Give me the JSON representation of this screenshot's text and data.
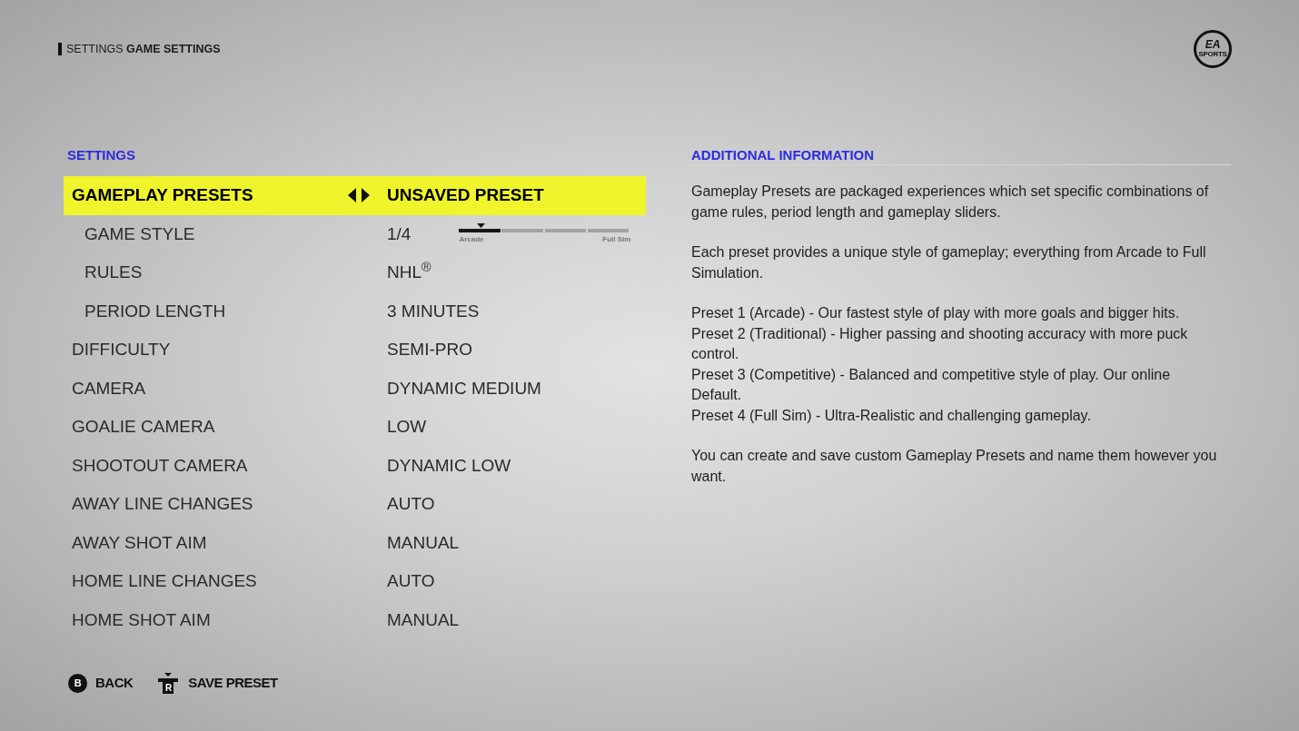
{
  "header": {
    "breadcrumb": "SETTINGS **GAME SETTINGS**",
    "logo": {
      "mark": "EA",
      "caption": "SPORTS"
    }
  },
  "settings": {
    "title": "SETTINGS",
    "rows": [
      {
        "label": "GAMEPLAY PRESETS",
        "value": "UNSAVED PRESET",
        "selected": true,
        "children": [
          {
            "kind": "slider",
            "label": "GAME STYLE",
            "value": "1/4",
            "selected": false,
            "level": 0.25,
            "min_label": "Arcade",
            "max_label": "Full Sim"
          },
          {
            "kind": "value",
            "label": "RULES",
            "value": "NHL$^{®}$",
            "selected": false
          },
          {
            "kind": "value",
            "label": "PERIOD LENGTH",
            "value": "3 MINUTES",
            "selected": false
          }
        ]
      },
      {
        "label": "DIFFICULTY",
        "value": "SEMI-PRO",
        "selected": false
      },
      {
        "label": "CAMERA",
        "value": "DYNAMIC MEDIUM",
        "selected": false
      },
      {
        "label": "GOALIE CAMERA",
        "value": "LOW",
        "selected": false
      },
      {
        "label": "SHOOTOUT CAMERA",
        "value": "DYNAMIC LOW",
        "selected": false
      },
      {
        "label": "AWAY LINE CHANGES",
        "value": "AUTO",
        "selected": false
      },
      {
        "label": "AWAY SHOT AIM",
        "value": "MANUAL",
        "selected": false
      },
      {
        "label": "HOME LINE CHANGES",
        "value": "AUTO",
        "selected": false
      },
      {
        "label": "HOME SHOT AIM",
        "value": "MANUAL",
        "selected": false
      }
    ]
  },
  "additional_information": {
    "title": "ADDITIONAL INFORMATION",
    "blocks": [
      {
        "lines": [
          "Gameplay Presets are packaged experiences which set specific combinations of game rules, period length and gameplay sliders."
        ]
      },
      {
        "lines": [
          "Each preset provides a unique style of gameplay; everything from Arcade to Full Simulation."
        ]
      },
      {
        "lines": [
          "Preset 1 (Arcade) - Our fastest style of play with more goals and bigger hits.",
          "Preset 2 (Traditional) - Higher passing and shooting accuracy with more puck control.",
          "Preset 3 (Competitive) - Balanced and competitive style of play. Our online Default.",
          "Preset 4 (Full Sim) - Ultra-Realistic and challenging gameplay."
        ]
      },
      {
        "lines": [
          "You can create and save custom Gameplay Presets and name them however you want."
        ]
      }
    ]
  },
  "footer": {
    "actions": [
      {
        "kind": "circle",
        "key": "B",
        "label": "BACK"
      },
      {
        "kind": "stick",
        "key": "R",
        "label": "SAVE PRESET"
      }
    ]
  }
}
